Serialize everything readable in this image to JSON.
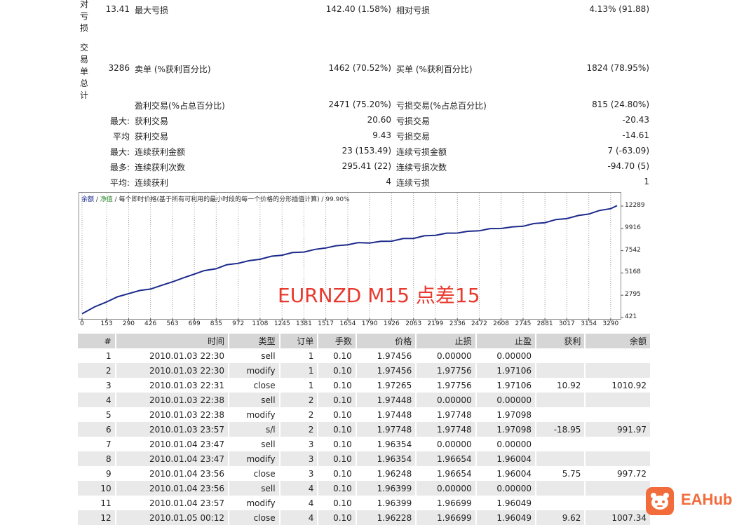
{
  "summary": {
    "row_drawdown": {
      "vlabel": "对亏损",
      "lead_value": "13.41",
      "label1": "最大亏损",
      "value1": "142.40 (1.58%)",
      "label2": "相对亏损",
      "value2": "4.13% (91.88)"
    },
    "row_total": {
      "vlabel": "交易单总计",
      "lead_value": "3286",
      "label1": "卖单 (%获利百分比)",
      "value1": "1462 (70.52%)",
      "label2": "买单 (%获利百分比)",
      "value2": "1824 (78.95%)"
    },
    "stats": [
      {
        "prefix": "",
        "label1": "盈利交易(%占总百分比)",
        "value1": "2471 (75.20%)",
        "label2": "亏损交易(%占总百分比)",
        "value2": "815 (24.80%)"
      },
      {
        "prefix": "最大:",
        "label1": "获利交易",
        "value1": "20.60",
        "label2": "亏损交易",
        "value2": "-20.43"
      },
      {
        "prefix": "平均",
        "label1": "获利交易",
        "value1": "9.43",
        "label2": "亏损交易",
        "value2": "-14.61"
      },
      {
        "prefix": "最大:",
        "label1": "连续获利金额",
        "value1": "23 (153.49)",
        "label2": "连续亏损金额",
        "value2": "7 (-63.09)"
      },
      {
        "prefix": "最多:",
        "label1": "连续获利次数",
        "value1": "295.41 (22)",
        "label2": "连续亏损次数",
        "value2": "-94.70 (5)"
      },
      {
        "prefix": "平均:",
        "label1": "连续获利",
        "value1": "4",
        "label2": "连续亏损",
        "value2": "1"
      }
    ]
  },
  "chart": {
    "legend_balance": "余额",
    "legend_sep1": " / ",
    "legend_equity": "净值",
    "legend_rest": " / 每个即时价格(基于所有可利用的最小时段的每一个价格的分形插值计算) / 99.90%",
    "watermark": "EURNZD M15 点差15",
    "colors": {
      "balance": "#1b2a8c",
      "equity": "#2e8b2e",
      "watermark": "#e8392e",
      "grid": "#9a9a9a"
    }
  },
  "chart_data": {
    "type": "line",
    "title": "",
    "xlabel": "",
    "ylabel": "",
    "y_ticks": [
      "12289",
      "9916",
      "7542",
      "5168",
      "2795",
      "421"
    ],
    "x_ticks": [
      "0",
      "153",
      "290",
      "426",
      "563",
      "699",
      "835",
      "972",
      "1108",
      "1245",
      "1381",
      "1517",
      "1654",
      "1790",
      "1926",
      "2063",
      "2199",
      "2336",
      "2472",
      "2608",
      "2745",
      "2881",
      "3017",
      "3154",
      "3290"
    ],
    "xlim": [
      0,
      3330
    ],
    "ylim": [
      421,
      12289
    ],
    "series": [
      {
        "x": [
          0,
          80,
          150,
          220,
          290,
          360,
          426,
          500,
          563,
          630,
          699,
          760,
          835,
          900,
          972,
          1040,
          1108,
          1180,
          1245,
          1310,
          1381,
          1450,
          1517,
          1580,
          1654,
          1720,
          1790,
          1860,
          1926,
          2000,
          2063,
          2130,
          2199,
          2270,
          2336,
          2400,
          2472,
          2540,
          2608,
          2680,
          2745,
          2810,
          2881,
          2950,
          3017,
          3090,
          3154,
          3220,
          3290,
          3330
        ],
        "y": [
          421,
          1100,
          1700,
          2200,
          2650,
          2900,
          3150,
          3500,
          3950,
          4300,
          4800,
          5100,
          5400,
          5750,
          6000,
          6200,
          6450,
          6700,
          6900,
          7100,
          7250,
          7450,
          7700,
          7850,
          8050,
          8200,
          8250,
          8350,
          8450,
          8650,
          8750,
          8950,
          9100,
          9250,
          9350,
          9450,
          9600,
          9750,
          9850,
          9950,
          10100,
          10300,
          10500,
          10750,
          10950,
          11200,
          11450,
          11750,
          12050,
          12289
        ]
      }
    ],
    "grid": true,
    "legend": "top-left"
  },
  "table": {
    "headers": [
      "#",
      "时间",
      "类型",
      "订单",
      "手数",
      "价格",
      "止损",
      "止盈",
      "获利",
      "余额"
    ],
    "rows": [
      [
        "1",
        "2010.01.03 22:30",
        "sell",
        "1",
        "0.10",
        "1.97456",
        "0.00000",
        "0.00000",
        "",
        ""
      ],
      [
        "2",
        "2010.01.03 22:30",
        "modify",
        "1",
        "0.10",
        "1.97456",
        "1.97756",
        "1.97106",
        "",
        ""
      ],
      [
        "3",
        "2010.01.03 22:31",
        "close",
        "1",
        "0.10",
        "1.97265",
        "1.97756",
        "1.97106",
        "10.92",
        "1010.92"
      ],
      [
        "4",
        "2010.01.03 22:38",
        "sell",
        "2",
        "0.10",
        "1.97448",
        "0.00000",
        "0.00000",
        "",
        ""
      ],
      [
        "5",
        "2010.01.03 22:38",
        "modify",
        "2",
        "0.10",
        "1.97448",
        "1.97748",
        "1.97098",
        "",
        ""
      ],
      [
        "6",
        "2010.01.03 23:57",
        "s/l",
        "2",
        "0.10",
        "1.97748",
        "1.97748",
        "1.97098",
        "-18.95",
        "991.97"
      ],
      [
        "7",
        "2010.01.04 23:47",
        "sell",
        "3",
        "0.10",
        "1.96354",
        "0.00000",
        "0.00000",
        "",
        ""
      ],
      [
        "8",
        "2010.01.04 23:47",
        "modify",
        "3",
        "0.10",
        "1.96354",
        "1.96654",
        "1.96004",
        "",
        ""
      ],
      [
        "9",
        "2010.01.04 23:56",
        "close",
        "3",
        "0.10",
        "1.96248",
        "1.96654",
        "1.96004",
        "5.75",
        "997.72"
      ],
      [
        "10",
        "2010.01.04 23:56",
        "sell",
        "4",
        "0.10",
        "1.96399",
        "0.00000",
        "0.00000",
        "",
        ""
      ],
      [
        "11",
        "2010.01.04 23:57",
        "modify",
        "4",
        "0.10",
        "1.96399",
        "1.96699",
        "1.96049",
        "",
        ""
      ],
      [
        "12",
        "2010.01.05 00:12",
        "close",
        "4",
        "0.10",
        "1.96228",
        "1.96699",
        "1.96049",
        "9.62",
        "1007.34"
      ]
    ]
  },
  "logo": {
    "text": "EAHub",
    "color": "#f26b3a"
  }
}
